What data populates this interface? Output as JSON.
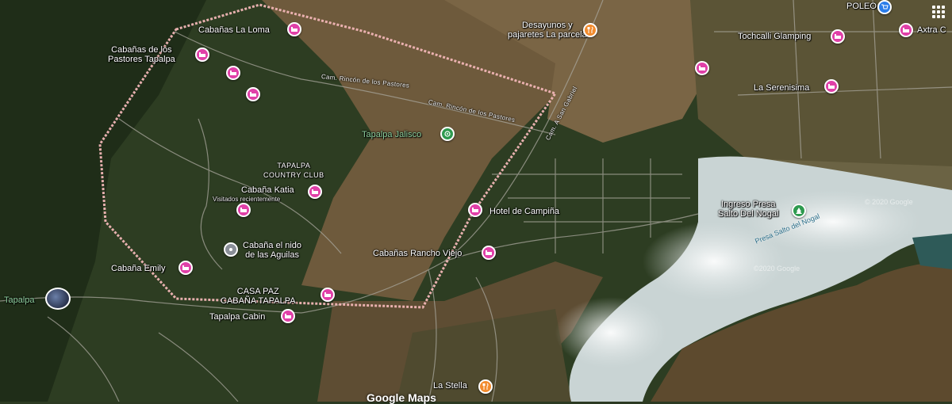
{
  "map": {
    "places": [
      {
        "id": "cabanas-la-loma",
        "label": "Cabañas La Loma",
        "type": "hotel"
      },
      {
        "id": "cabanas-pastores",
        "label": "Cabañas de los\nPastores Tapalpa",
        "type": "hotel"
      },
      {
        "id": "desayunos",
        "label": "Desayunos y\npajaretes La parcela",
        "type": "food"
      },
      {
        "id": "tochcalli",
        "label": "Tochcalli Glamping",
        "type": "hotel"
      },
      {
        "id": "poleo",
        "label": "POLEO",
        "type": "shop"
      },
      {
        "id": "axtra",
        "label": "Axtra C",
        "type": "hotel"
      },
      {
        "id": "la-serenisima",
        "label": "La Serenisima",
        "type": "hotel"
      },
      {
        "id": "tapalpa-jalisco",
        "label": "Tapalpa Jalisco",
        "type": "park"
      },
      {
        "id": "tapalpa-country-club",
        "label": "TAPALPA\nCOUNTRY CLUB",
        "type": "area"
      },
      {
        "id": "cabana-katia",
        "label": "Cabaña Katia",
        "sublabel": "Visitados recientemente",
        "type": "hotel"
      },
      {
        "id": "hotel-campina",
        "label": "Hotel de Campiña",
        "type": "hotel"
      },
      {
        "id": "ingreso-presa",
        "label": "Ingreso Presa\nSalto Del Nogal",
        "type": "park"
      },
      {
        "id": "cabana-nido",
        "label": "Cabaña el nido\nde las Aguilas",
        "type": "saved"
      },
      {
        "id": "cabanas-rancho-viejo",
        "label": "Cabañas Rancho Viejo",
        "type": "hotel"
      },
      {
        "id": "cabana-emily",
        "label": "Cabaña Emily",
        "type": "hotel"
      },
      {
        "id": "casa-paz",
        "label": "CASA PAZ\nCABAÑA TAPALPA",
        "type": "hotel"
      },
      {
        "id": "tapalpa-cabin",
        "label": "Tapalpa Cabin",
        "type": "hotel"
      },
      {
        "id": "tapalpa",
        "label": "Tapalpa",
        "type": "town"
      },
      {
        "id": "la-stella",
        "label": "La Stella",
        "type": "food"
      }
    ],
    "roads": {
      "rincon_1": "Cam. Rincón de los Pastores",
      "rincon_2": "Cam. Rincón de los Pastores",
      "san_gabriel": "Cam. A San Gabriel"
    },
    "water_label": "Presa Salto del Nogal",
    "watermark": "Google Maps",
    "copyright": "© 2020 Google",
    "copyright_2": "©2020 Google",
    "colors": {
      "boundary": "#f1b6b6",
      "hotel_pin": "#e040a8",
      "food_pin": "#f28b2d",
      "park_pin": "#2e9a4f",
      "shop_pin": "#2b7de9",
      "water": "#c9d4d4"
    }
  }
}
